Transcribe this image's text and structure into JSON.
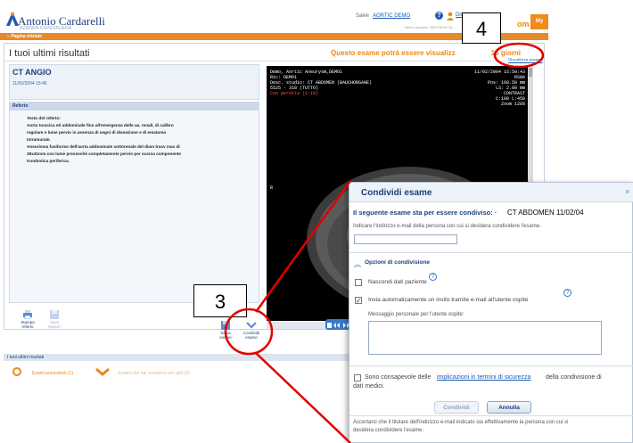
{
  "header": {
    "logo_text": "Antonio Cardarelli",
    "logo_sub": "AZIENDA OSPEDALIERA",
    "greeting": "Salve",
    "greeting_user": "AORTIC DEMO",
    "last_access": "ultimo accesso 25/07/2018 15:...",
    "user_link": "Disconn...",
    "brand_text": "om",
    "brand_logo": "My"
  },
  "nav": {
    "home": "Pagina Iniziale"
  },
  "main": {
    "title": "I tuoi ultimi risultati",
    "visibility_note": "Questo esame potrà essere visualizz",
    "visibility_suffix": "15 giorni",
    "view_exam": "Visualizza esame"
  },
  "exam": {
    "title": "CT ANGIO",
    "date": "11/02/2004 15:46",
    "report_header": "Referto",
    "report_lines": [
      "Testo del referto:",
      "Aorta toracica ed addominale fino all'emergenza delle aa. renali, di calibro",
      "regolare e lume pervio in assenza di segni di dissezione e di ematoma",
      "intramurale.",
      "Aneurisma fusiforme dell'aorta addominale sottorenale del diam trasv max di",
      "39x41mm con lume pressoché completamente pervio per scarsa componente",
      "trombotica periferica."
    ]
  },
  "viewer": {
    "left_info": [
      "Demo, Aortic Aneurysm,DEMO1",
      "Ric: DEMO1",
      "Desc. studio: CT ABDOMEN (BAUCHORGANE)",
      "5525 - 318 (TUTTO)"
    ],
    "lossy": "Con perdita (1:10)",
    "right_info": [
      "11/02/2004 15:50:43",
      "RSNA",
      "Pos: 168.50 mm",
      "LS: 2.00 mm",
      "CONTRAST",
      "C:100 L:450",
      "Zoom 128%"
    ],
    "orientation_r": "R"
  },
  "toolbar": {
    "print": "Stampa referto",
    "save": "Save Report",
    "save_exam": "Salva esame",
    "share_exam": "Condividi esame"
  },
  "bottom": {
    "section_label": "I tuoi ultimi risultati",
    "prev_exams": "Esami precedenti (1)",
    "shared_exams": "Esami che hai condiviso con altri (0)"
  },
  "callouts": {
    "four": "4",
    "three": "3"
  },
  "dialog": {
    "title": "Condividi esame",
    "close": "×",
    "intro": "Il seguente esame sta per essere condiviso: ·",
    "exam_name": "CT ABDOMEN 11/02/04",
    "email_hint": "Indicare l'indirizzo e-mail della persona con cui si desidera condividere l'esame.",
    "email_value": "",
    "options_title": "Opzioni di condivisione",
    "hide_data": "Nascondi dati paziente",
    "hide_data_checked": false,
    "invite": "Invia automaticamente un invito tramite e-mail all'utente ospite",
    "invite_checked": true,
    "message_label": "Messaggio personale per l'utente ospite:",
    "message_value": "",
    "consent_1": "Sono consapevole delle",
    "consent_link": "implicazioni in termini di sicurezza",
    "consent_2": "della condivisione di",
    "consent_3": "dati medici.",
    "share_button": "Condividi",
    "cancel_button": "Annulla",
    "footer_1": "Accertarsi che il titolare dell'indirizzo e-mail indicato sia effettivamente la persona con cui si",
    "footer_2": "desidera condividere l'esame."
  },
  "colors": {
    "accent": "#e8891b",
    "brand_blue": "#1e3f7a",
    "annotation": "#e00000"
  }
}
